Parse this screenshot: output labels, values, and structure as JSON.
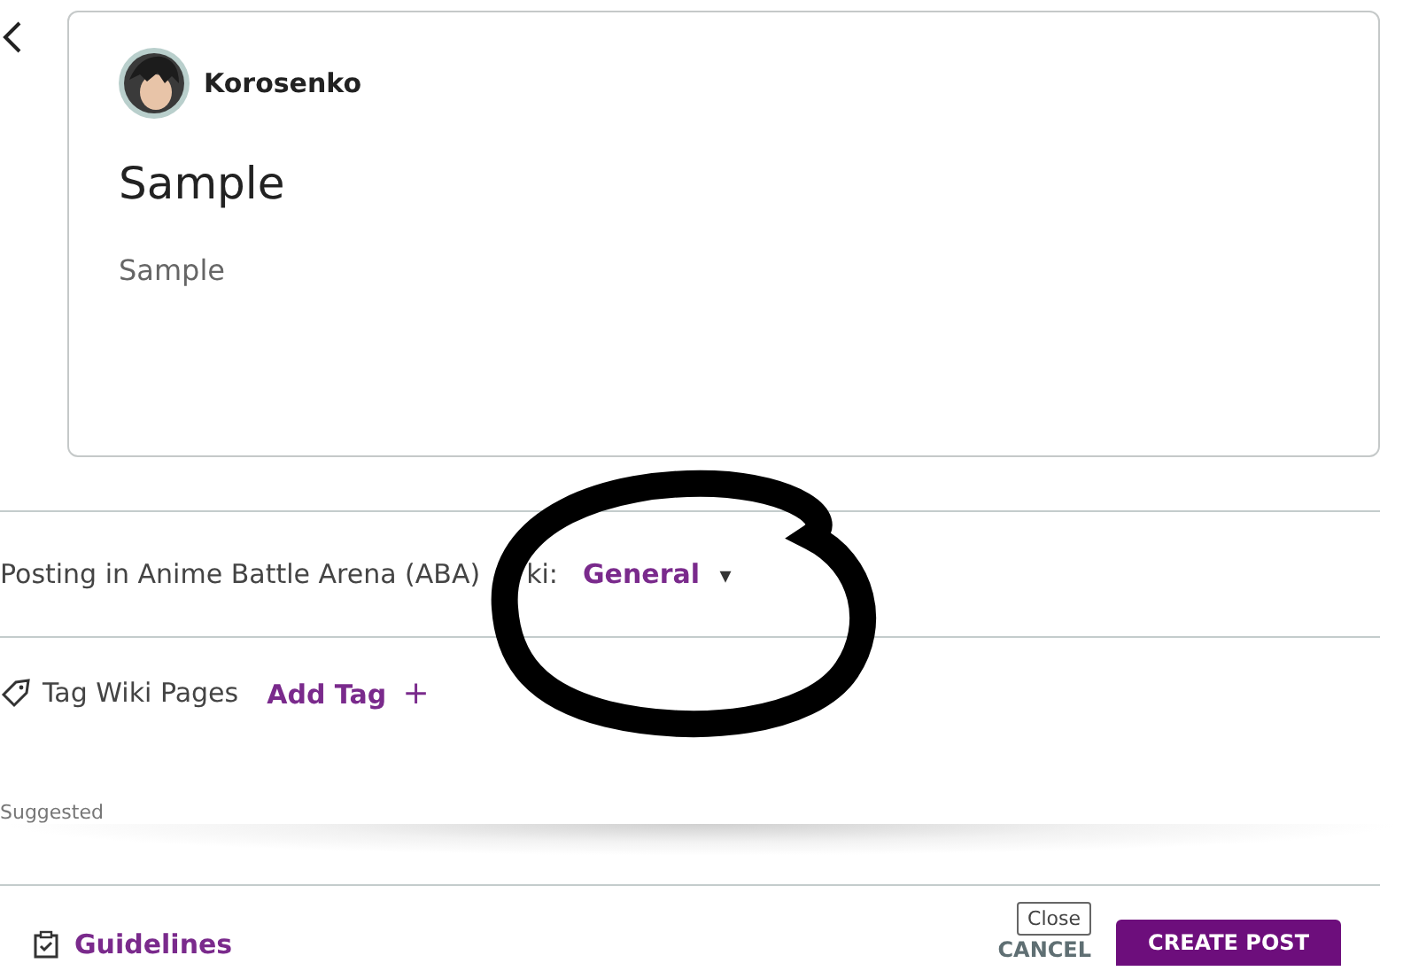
{
  "post_preview": {
    "author": "Korosenko",
    "title": "Sample",
    "body": "Sample"
  },
  "posting": {
    "label": "Posting in Anime Battle Arena (ABA)",
    "label_end": "ki:",
    "category": "General",
    "caret": "▾"
  },
  "tags": {
    "label": "Tag Wiki Pages",
    "add": "Add Tag",
    "plus": "+"
  },
  "suggested": "Suggested",
  "footer": {
    "guidelines": "Guidelines",
    "cancel": "CANCEL",
    "tooltip": "Close",
    "create": "CREATE POST"
  }
}
